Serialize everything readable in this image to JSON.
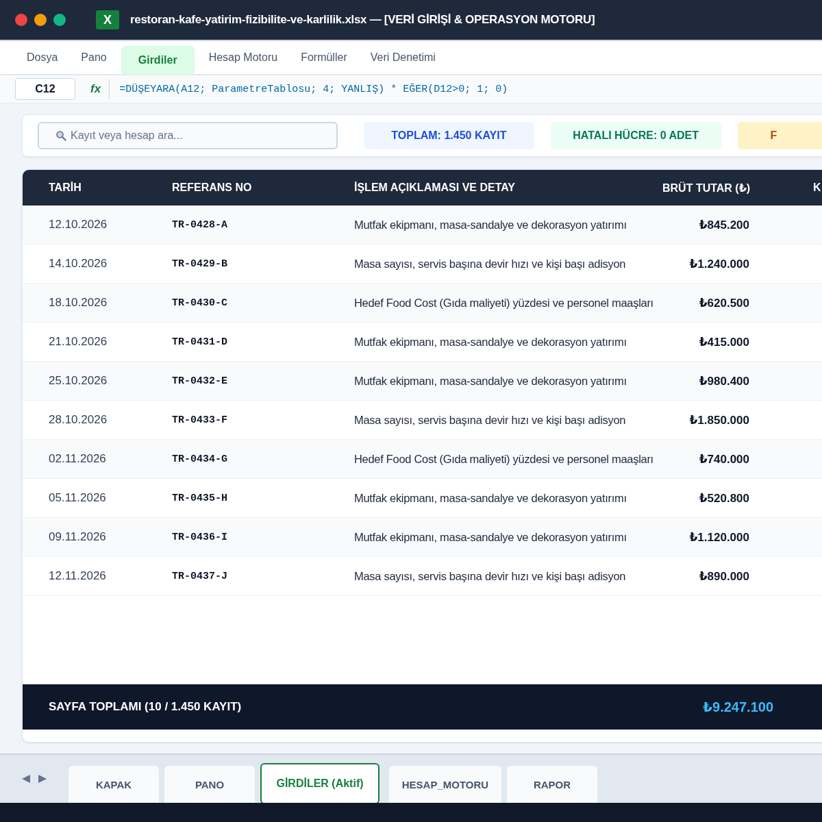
{
  "window": {
    "title": "restoran-kafe-yatirim-fizibilite-ve-karlilik.xlsx — [VERİ GİRİŞİ & OPERASYON MOTORU]",
    "app_badge": "X"
  },
  "menu": [
    {
      "label": "Dosya",
      "selected": false
    },
    {
      "label": "Pano",
      "selected": false
    },
    {
      "label": "Girdiler",
      "selected": true
    },
    {
      "label": "Hesap Motoru",
      "selected": false
    },
    {
      "label": "Formüller",
      "selected": false
    },
    {
      "label": "Veri Denetimi",
      "selected": false
    }
  ],
  "formula_bar": {
    "cell": "C12",
    "fx": "fx",
    "formula": "=DÜŞEYARA(A12; ParametreTablosu; 4; YANLIŞ) * EĞER(D12>0; 1; 0)"
  },
  "search": {
    "placeholder": "Kayıt veya hesap ara..."
  },
  "badges": [
    {
      "text": "TOPLAM: 1.450 KAYIT",
      "kind": "info"
    },
    {
      "text": "HATALI HÜCRE: 0 ADET",
      "kind": "success"
    },
    {
      "text": "F",
      "kind": "warning"
    }
  ],
  "table": {
    "columns": [
      "TARİH",
      "REFERANS NO",
      "İŞLEM AÇIKLAMASI VE DETAY",
      "BRÜT TUTAR (₺)",
      "K"
    ],
    "rows": [
      [
        "12.10.2026",
        "TR-0428-A",
        "Mutfak ekipmanı, masa-sandalye ve dekorasyon yatırımı",
        "₺845.200"
      ],
      [
        "14.10.2026",
        "TR-0429-B",
        "Masa sayısı, servis başına devir hızı ve kişi başı adisyon",
        "₺1.240.000"
      ],
      [
        "18.10.2026",
        "TR-0430-C",
        "Hedef Food Cost (Gıda maliyeti) yüzdesi ve personel maaşları",
        "₺620.500"
      ],
      [
        "21.10.2026",
        "TR-0431-D",
        "Mutfak ekipmanı, masa-sandalye ve dekorasyon yatırımı",
        "₺415.000"
      ],
      [
        "25.10.2026",
        "TR-0432-E",
        "Mutfak ekipmanı, masa-sandalye ve dekorasyon yatırımı",
        "₺980.400"
      ],
      [
        "28.10.2026",
        "TR-0433-F",
        "Masa sayısı, servis başına devir hızı ve kişi başı adisyon",
        "₺1.850.000"
      ],
      [
        "02.11.2026",
        "TR-0434-G",
        "Hedef Food Cost (Gıda maliyeti) yüzdesi ve personel maaşları",
        "₺740.000"
      ],
      [
        "05.11.2026",
        "TR-0435-H",
        "Mutfak ekipmanı, masa-sandalye ve dekorasyon yatırımı",
        "₺520.800"
      ],
      [
        "09.11.2026",
        "TR-0436-I",
        "Mutfak ekipmanı, masa-sandalye ve dekorasyon yatırımı",
        "₺1.120.000"
      ],
      [
        "12.11.2026",
        "TR-0437-J",
        "Masa sayısı, servis başına devir hızı ve kişi başı adisyon",
        "₺890.000"
      ]
    ],
    "footer": {
      "label": "SAYFA TOPLAMI (10 / 1.450 KAYIT)",
      "total": "₺9.247.100"
    }
  },
  "sheet_tabs": [
    {
      "label": "KAPAK",
      "selected": false
    },
    {
      "label": "PANO",
      "selected": false
    },
    {
      "label": "GİRDİLER (Aktif)",
      "selected": true
    },
    {
      "label": "HESAP_MOTORU",
      "selected": false
    },
    {
      "label": "RAPOR",
      "selected": false
    }
  ]
}
